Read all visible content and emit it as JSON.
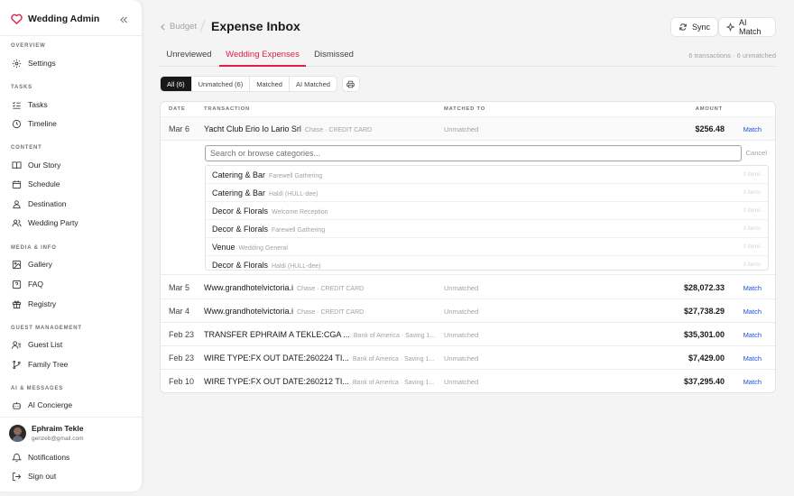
{
  "brand": {
    "name": "Wedding Admin"
  },
  "sidebar": {
    "sections": [
      {
        "label": "OVERVIEW",
        "items": [
          {
            "label": "Settings",
            "icon": "gear-icon"
          }
        ]
      },
      {
        "label": "TASKS",
        "items": [
          {
            "label": "Tasks",
            "icon": "list-check-icon"
          },
          {
            "label": "Timeline",
            "icon": "clock-icon"
          }
        ]
      },
      {
        "label": "CONTENT",
        "items": [
          {
            "label": "Our Story",
            "icon": "book-icon"
          },
          {
            "label": "Schedule",
            "icon": "calendar-icon"
          },
          {
            "label": "Destination",
            "icon": "user-pin-icon"
          },
          {
            "label": "Wedding Party",
            "icon": "users-icon"
          }
        ]
      },
      {
        "label": "MEDIA & INFO",
        "items": [
          {
            "label": "Gallery",
            "icon": "image-icon"
          },
          {
            "label": "FAQ",
            "icon": "help-circle-icon"
          },
          {
            "label": "Registry",
            "icon": "gift-icon"
          }
        ]
      },
      {
        "label": "GUEST MANAGEMENT",
        "items": [
          {
            "label": "Guest List",
            "icon": "user-list-icon"
          },
          {
            "label": "Family Tree",
            "icon": "git-branch-icon"
          }
        ]
      },
      {
        "label": "AI & MESSAGES",
        "items": [
          {
            "label": "AI Concierge",
            "icon": "bot-icon"
          }
        ]
      }
    ],
    "user": {
      "name": "Ephraim Tekle",
      "email": "genzeb@gmail.com"
    },
    "footer": [
      {
        "label": "Notifications",
        "icon": "bell-icon"
      },
      {
        "label": "Sign out",
        "icon": "sign-out-icon"
      }
    ]
  },
  "header": {
    "breadcrumb": "Budget",
    "title": "Expense Inbox",
    "sync_label": "Sync",
    "ai_match_label": "AI Match"
  },
  "tabs": [
    {
      "label": "Unreviewed",
      "active": false
    },
    {
      "label": "Wedding Expenses",
      "active": true
    },
    {
      "label": "Dismissed",
      "active": false
    }
  ],
  "tx_summary": "6 transactions · 6 unmatched",
  "filters": [
    {
      "label": "All (6)",
      "active": true
    },
    {
      "label": "Unmatched (6)",
      "active": false
    },
    {
      "label": "Matched",
      "active": false
    },
    {
      "label": "AI Matched",
      "active": false
    }
  ],
  "table": {
    "headers": {
      "date": "DATE",
      "transaction": "TRANSACTION",
      "matched": "MATCHED TO",
      "amount": "AMOUNT"
    },
    "rows": [
      {
        "date": "Mar 6",
        "name": "Yacht Club Erio Io Lario Srl",
        "source": "Chase · CREDIT CARD",
        "matched": "Unmatched",
        "amount": "$256.48",
        "action": "Match"
      },
      {
        "date": "Mar 5",
        "name": "Www.grandhotelvictoria.i",
        "source": "Chase · CREDIT CARD",
        "matched": "Unmatched",
        "amount": "$28,072.33",
        "action": "Match"
      },
      {
        "date": "Mar 4",
        "name": "Www.grandhotelvictoria.i",
        "source": "Chase · CREDIT CARD",
        "matched": "Unmatched",
        "amount": "$27,738.29",
        "action": "Match"
      },
      {
        "date": "Feb 23",
        "name": "TRANSFER EPHRAIM A TEKLE:CGA ...",
        "source": "Bank of America · Saving 1...",
        "matched": "Unmatched",
        "amount": "$35,301.00",
        "action": "Match"
      },
      {
        "date": "Feb 23",
        "name": "WIRE TYPE:FX OUT DATE:260224 TI...",
        "source": "Bank of America · Saving 1...",
        "matched": "Unmatched",
        "amount": "$7,429.00",
        "action": "Match"
      },
      {
        "date": "Feb 10",
        "name": "WIRE TYPE:FX OUT DATE:260212 TI...",
        "source": "Bank of America · Saving 1...",
        "matched": "Unmatched",
        "amount": "$37,295.40",
        "action": "Match"
      }
    ]
  },
  "category_picker": {
    "placeholder": "Search or browse categories...",
    "cancel_label": "Cancel",
    "items": [
      {
        "name": "Catering & Bar",
        "context": "Farewell Gathering",
        "count": "0 items"
      },
      {
        "name": "Catering & Bar",
        "context": "Haldi (HULL-dee)",
        "count": "0 items"
      },
      {
        "name": "Decor & Florals",
        "context": "Welcome Reception",
        "count": "0 items"
      },
      {
        "name": "Decor & Florals",
        "context": "Farewell Gathering",
        "count": "0 items"
      },
      {
        "name": "Venue",
        "context": "Wedding General",
        "count": "0 items"
      },
      {
        "name": "Decor & Florals",
        "context": "Haldi (HULL-dee)",
        "count": "0 items"
      }
    ]
  },
  "colors": {
    "accent": "#e11d48",
    "link": "#1d4ed8",
    "dark": "#18181b"
  }
}
